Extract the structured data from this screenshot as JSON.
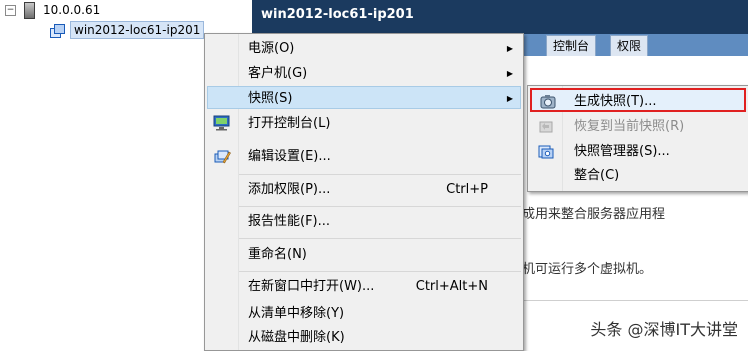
{
  "tree": {
    "host_label": "10.0.0.61",
    "host_expander": "−",
    "vm_label": "win2012-loc61-ip201"
  },
  "vm_header": {
    "title": "win2012-loc61-ip201"
  },
  "tabs": [
    {
      "label": "控制台"
    },
    {
      "label": "权限"
    }
  ],
  "content": {
    "line1": "成用来整合服务器应用程",
    "line2": "机可运行多个虚拟机。"
  },
  "context_menu": {
    "items": [
      {
        "label": "电源(O)",
        "submenu": true
      },
      {
        "label": "客户机(G)",
        "submenu": true
      },
      {
        "label": "快照(S)",
        "submenu": true,
        "active": true
      },
      {
        "label": "打开控制台(L)",
        "icon": "console-icon"
      },
      {
        "label": "编辑设置(E)...",
        "icon": "edit-settings-icon"
      },
      {
        "label": "添加权限(P)...",
        "shortcut": "Ctrl+P"
      },
      {
        "label": "报告性能(F)..."
      },
      {
        "label": "重命名(N)"
      },
      {
        "label": "在新窗口中打开(W)...",
        "shortcut": "Ctrl+Alt+N"
      },
      {
        "label": "从清单中移除(Y)"
      },
      {
        "label": "从磁盘中删除(K)"
      }
    ],
    "submenu_arrow": "▶"
  },
  "snapshot_submenu": {
    "items": [
      {
        "label": "生成快照(T)...",
        "icon": "take-snapshot-icon",
        "highlighted": true
      },
      {
        "label": "恢复到当前快照(R)",
        "icon": "revert-snapshot-icon",
        "disabled": true
      },
      {
        "label": "快照管理器(S)...",
        "icon": "snapshot-manager-icon"
      },
      {
        "label": "整合(C)"
      }
    ]
  },
  "watermark": "头条 @深博IT大讲堂",
  "colors": {
    "header_bg": "#1b3a5f",
    "tabstrip_bg": "#5f8cc0",
    "menu_bg": "#f0f0f0",
    "menu_active": "#cce4f7",
    "highlight_border": "#e02020"
  }
}
